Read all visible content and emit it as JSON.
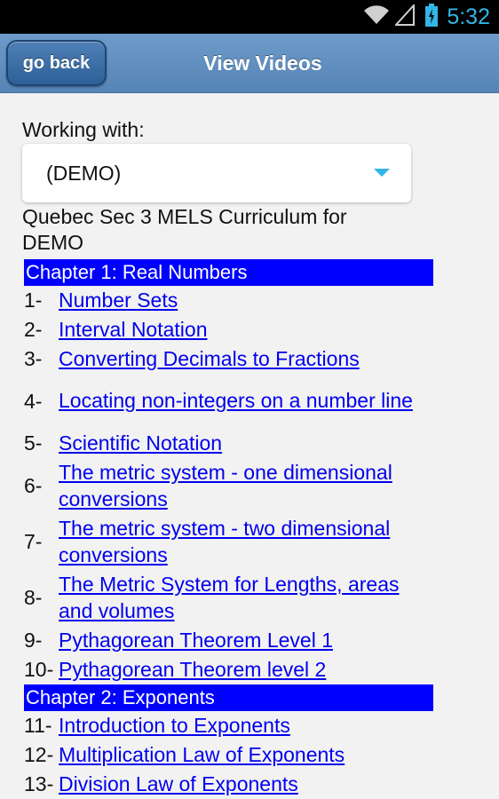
{
  "status_bar": {
    "time": "5:32",
    "icons": [
      "wifi-icon",
      "signal-icon",
      "battery-charging-icon"
    ]
  },
  "header": {
    "back_label": "go back",
    "title": "View Videos"
  },
  "main": {
    "working_with_label": "Working with:",
    "selected_option": "(DEMO)",
    "curriculum_title": "Quebec Sec 3 MELS Curriculum for DEMO",
    "chapters": [
      {
        "title": "Chapter 1: Real Numbers",
        "lessons": [
          {
            "num": "1-",
            "title": "Number Sets"
          },
          {
            "num": "2-",
            "title": "Interval Notation"
          },
          {
            "num": "3-",
            "title": "Converting Decimals to Fractions"
          },
          {
            "num": "4-",
            "title": "Locating non-integers on a number line"
          },
          {
            "num": "5-",
            "title": "Scientific Notation"
          },
          {
            "num": "6-",
            "title": "The metric system - one dimensional conversions"
          },
          {
            "num": "7-",
            "title": "The metric system - two dimensional conversions"
          },
          {
            "num": "8-",
            "title": "The Metric System for Lengths, areas and volumes"
          },
          {
            "num": "9-",
            "title": "Pythagorean Theorem Level 1"
          },
          {
            "num": "10-",
            "title": "Pythagorean Theorem level 2"
          }
        ]
      },
      {
        "title": "Chapter 2: Exponents",
        "lessons": [
          {
            "num": "11-",
            "title": "Introduction to Exponents"
          },
          {
            "num": "12-",
            "title": "Multiplication Law of Exponents"
          },
          {
            "num": "13-",
            "title": "Division Law of Exponents"
          }
        ]
      }
    ]
  },
  "colors": {
    "header_blue": "#5f8fc0",
    "chapter_blue": "#0000ff",
    "link_blue": "#0000ee",
    "accent": "#33b5e5",
    "background": "#f2f2f2"
  }
}
